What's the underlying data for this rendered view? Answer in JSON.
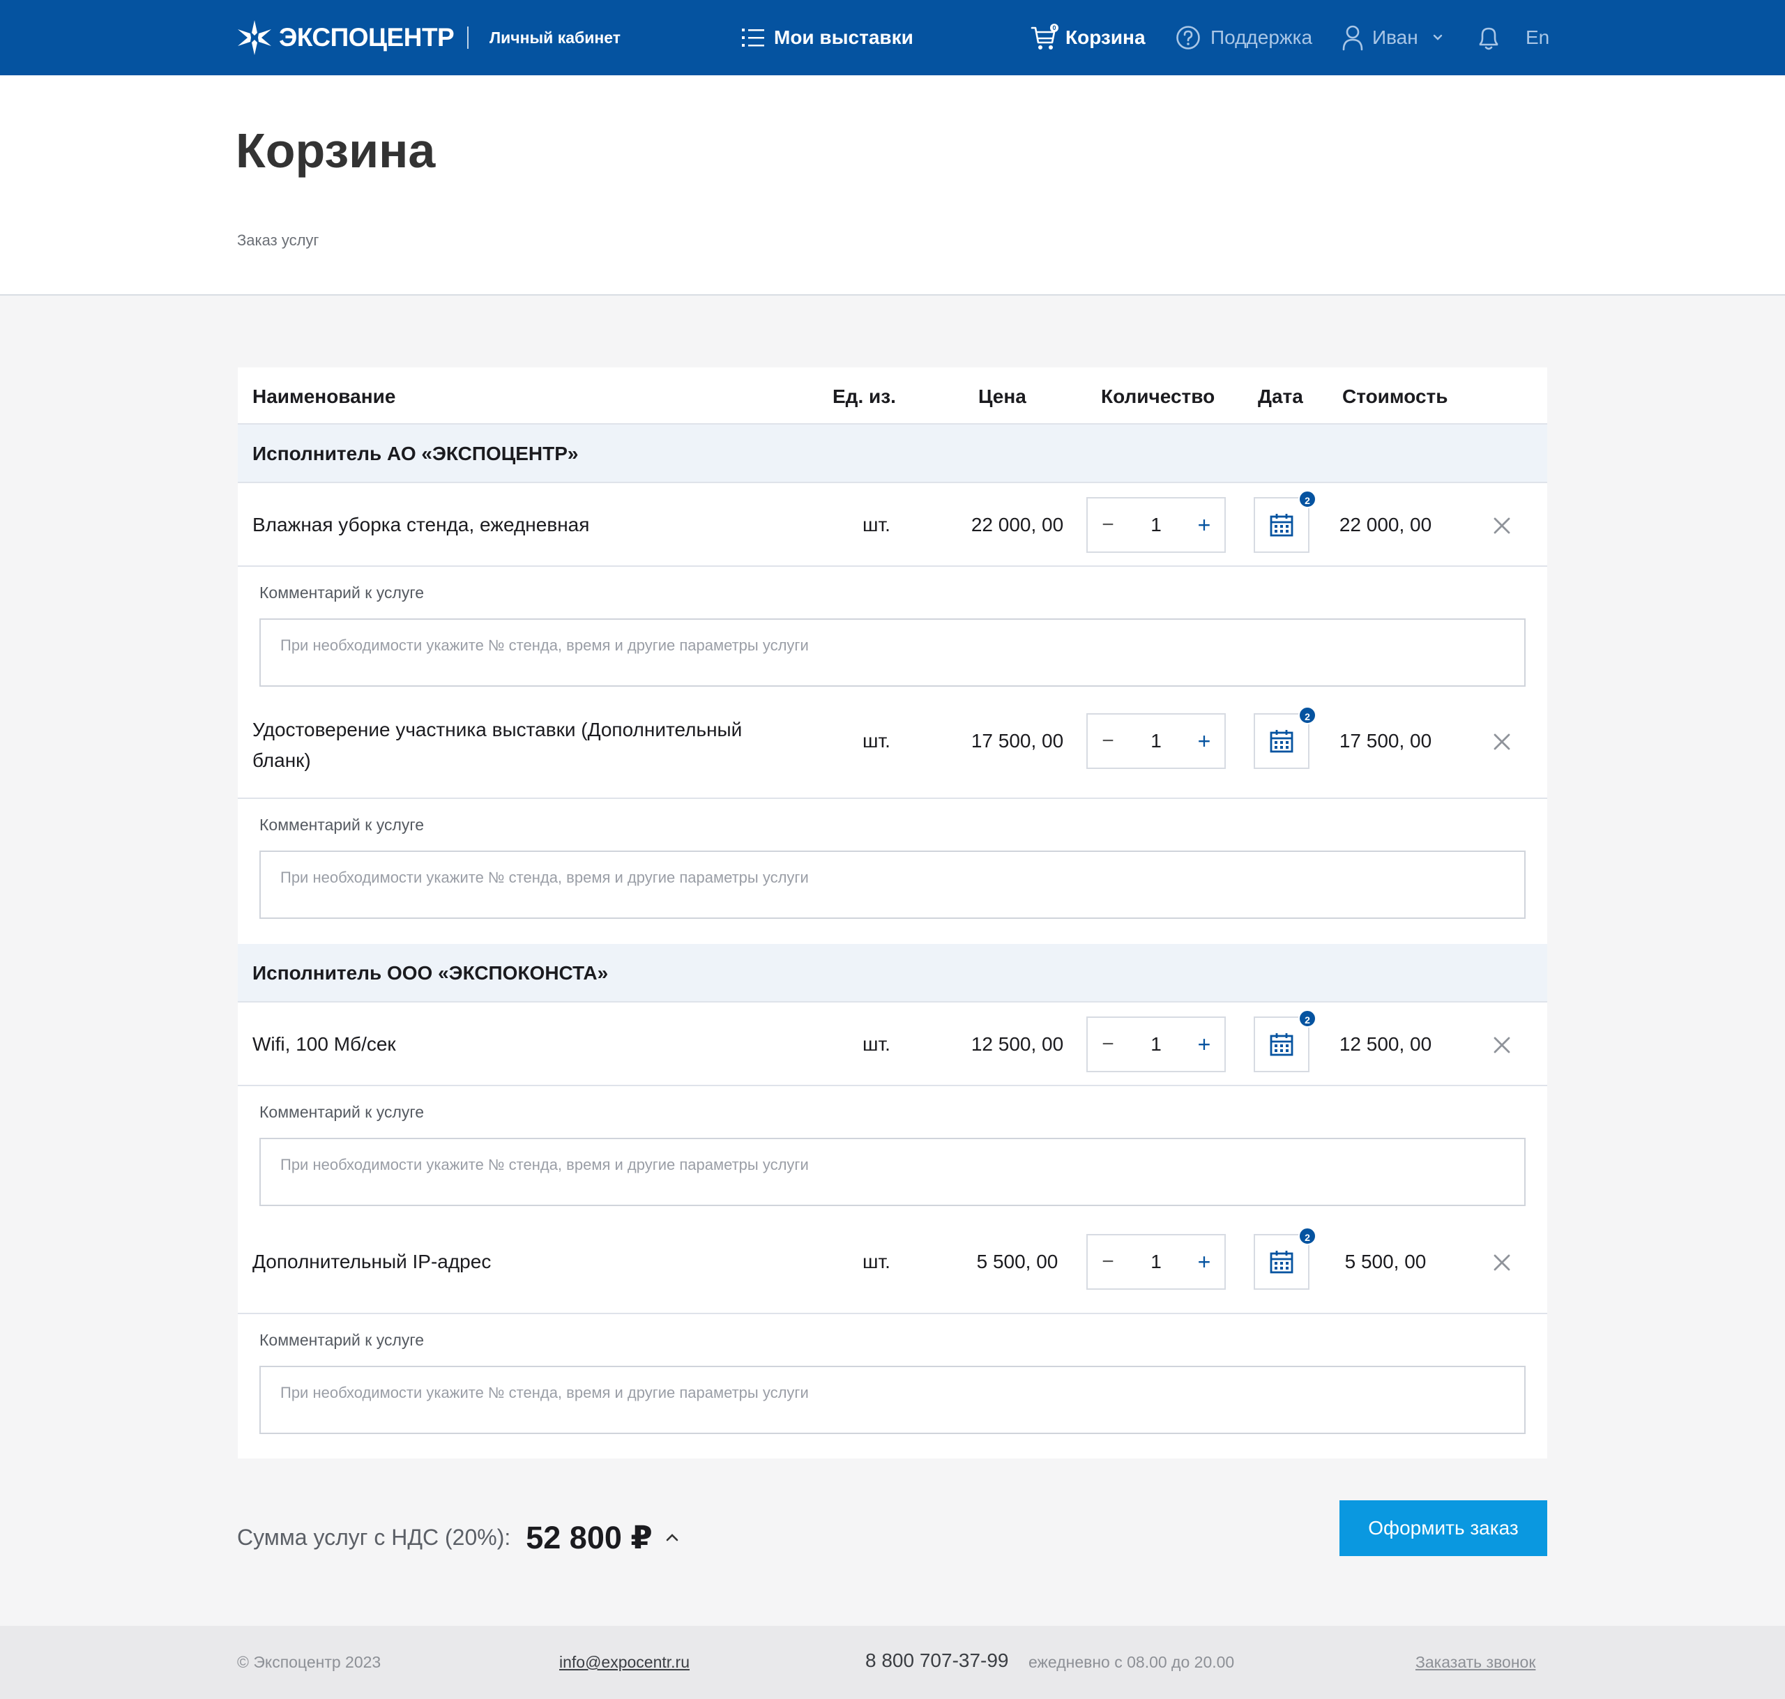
{
  "header": {
    "logo_text": "ЭКСПОЦЕНТР",
    "cabinet": "Личный кабинет",
    "nav": {
      "exhibitions": "Мои выставки",
      "cart": "Корзина",
      "cart_badge": "0",
      "support": "Поддержка",
      "user": "Иван",
      "lang": "En"
    }
  },
  "page": {
    "title": "Корзина",
    "breadcrumb": "Заказ услуг"
  },
  "table": {
    "headers": {
      "name": "Наименование",
      "unit": "Ед. из.",
      "price": "Цена",
      "quantity": "Количество",
      "date": "Дата",
      "cost": "Стоимость"
    },
    "groups": [
      {
        "title": "Исполнитель АО «ЭКСПОЦЕНТР»",
        "items": [
          {
            "name": "Влажная уборка стенда, ежедневная",
            "unit": "шт.",
            "price": "22 000, 00",
            "qty": "1",
            "date_badge": "2",
            "cost": "22 000, 00"
          },
          {
            "name": "Удостоверение участника выставки (Дополнительный бланк)",
            "unit": "шт.",
            "price": "17 500, 00",
            "qty": "1",
            "date_badge": "2",
            "cost": "17 500, 00"
          }
        ]
      },
      {
        "title": "Исполнитель ООО «ЭКСПОКОНСТА»",
        "items": [
          {
            "name": "Wifi, 100 Мб/сек",
            "unit": "шт.",
            "price": "12 500, 00",
            "qty": "1",
            "date_badge": "2",
            "cost": "12 500, 00"
          },
          {
            "name": "Дополнительный IP-адрес",
            "unit": "шт.",
            "price": "5 500, 00",
            "qty": "1",
            "date_badge": "2",
            "cost": "5 500, 00"
          }
        ]
      }
    ],
    "comment_label": "Комментарий к услуге",
    "comment_placeholder": "При необходимости укажите № стенда, время и другие параметры услуги",
    "qty_minus": "−",
    "qty_plus": "+"
  },
  "summary": {
    "label": "Сумма услуг с НДС (20%):",
    "value": "52 800 ₽",
    "order_button": "Оформить заказ"
  },
  "footer": {
    "copyright": "© Экспоцентр 2023",
    "email": "info@expocentr.ru",
    "phone": "8 800 707-37-99",
    "hours": "ежедневно с 08.00 до 20.00",
    "callback": "Заказать звонок"
  },
  "colors": {
    "header_bg": "#0553a0",
    "accent_button": "#0a98e0",
    "group_bg": "#eef3f9"
  }
}
